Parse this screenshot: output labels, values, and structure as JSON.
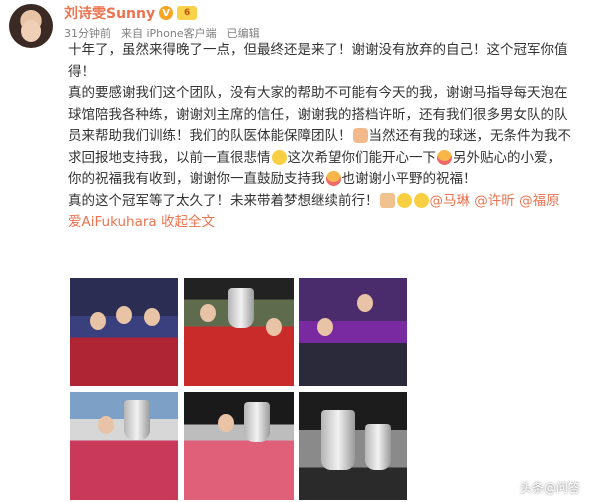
{
  "header": {
    "name": "刘诗雯Sunny",
    "verified_mark": "V",
    "level_badge": "6",
    "time": "31分钟前",
    "source": "来自 iPhone客户端",
    "edited": "已编辑"
  },
  "post": {
    "p1": "十年了，虽然来得晚了一点，但最终还是来了！谢谢没有放弃的自己！这个冠军你值得！",
    "p2_a": "真的要感谢我们这个团队，没有大家的帮助不可能有今天的我，谢谢马指导每天泡在球馆陪我各种练，谢谢刘主席的信任，谢谢我的搭档许昕，还有我们很多男女队的队员来帮助我们训练！我们的队医体能保障团队！",
    "p2_b": "当然还有我的球迷，无条件为我不求回报地支持我，以前一直很悲情",
    "p2_c": "这次希望你们能开心一下",
    "p2_d": "另外贴心的小爱，你的祝福我有收到，谢谢你一直鼓励支持我",
    "p2_e": "也谢谢小平野的祝福！",
    "p3_a": "真的这个冠军等了太久了！未来带着梦想继续前行！",
    "mention_1": "@马琳",
    "mention_2": "@许昕",
    "mention_3": "@福原爱AiFukuhara",
    "expand": "收起全文"
  },
  "emoji": [
    "doge-laugh",
    "clap",
    "kiss",
    "kiss",
    "muscle",
    "smile",
    "smile"
  ],
  "colors": {
    "accent": "#eb7350",
    "text": "#333333",
    "meta": "#808080"
  },
  "watermark": "头条@问答"
}
